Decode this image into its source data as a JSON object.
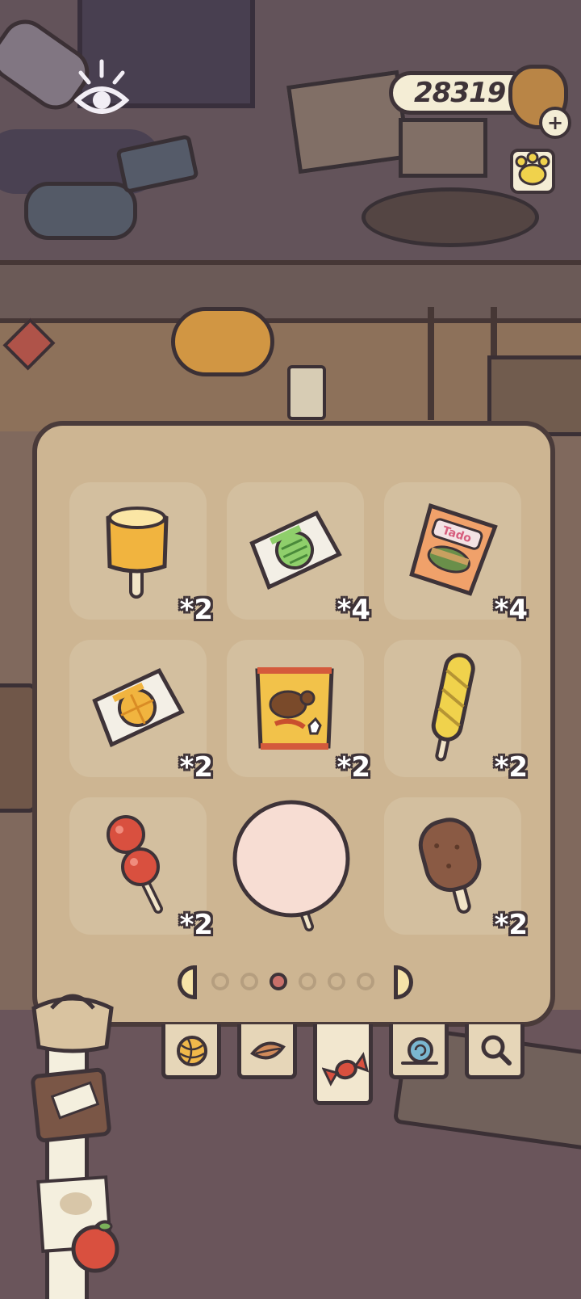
{
  "hud": {
    "currency_value": "28319",
    "add_symbol": "+"
  },
  "inventory": {
    "items": [
      {
        "name": "pudding-popsicle",
        "quantity": "*2"
      },
      {
        "name": "melon-candy",
        "quantity": "*4"
      },
      {
        "name": "gummy-snack-pack",
        "quantity": "*4"
      },
      {
        "name": "orange-candy",
        "quantity": "*2"
      },
      {
        "name": "chips-bag",
        "quantity": "*2"
      },
      {
        "name": "twisted-bread-stick",
        "quantity": "*2"
      },
      {
        "name": "candied-hawthorn",
        "quantity": "*2"
      },
      {
        "name": "peach-lollipop",
        "quantity": ""
      },
      {
        "name": "chocolate-ice-cream-bar",
        "quantity": "*2"
      }
    ],
    "packet_label": "Tado",
    "page_count": 6,
    "current_page": 3
  },
  "tabs": [
    {
      "name": "tab-yarn",
      "icon": "yarn-ball-icon",
      "active": false
    },
    {
      "name": "tab-leaf",
      "icon": "leaf-icon",
      "active": false
    },
    {
      "name": "tab-candy",
      "icon": "candy-icon",
      "active": true
    },
    {
      "name": "tab-snail",
      "icon": "snail-icon",
      "active": false
    },
    {
      "name": "tab-magnifier",
      "icon": "magnifier-icon",
      "active": false
    }
  ],
  "colors": {
    "panel_bg": "#cdb592",
    "outline": "#3e3338",
    "active_dot": "#c9706a"
  }
}
